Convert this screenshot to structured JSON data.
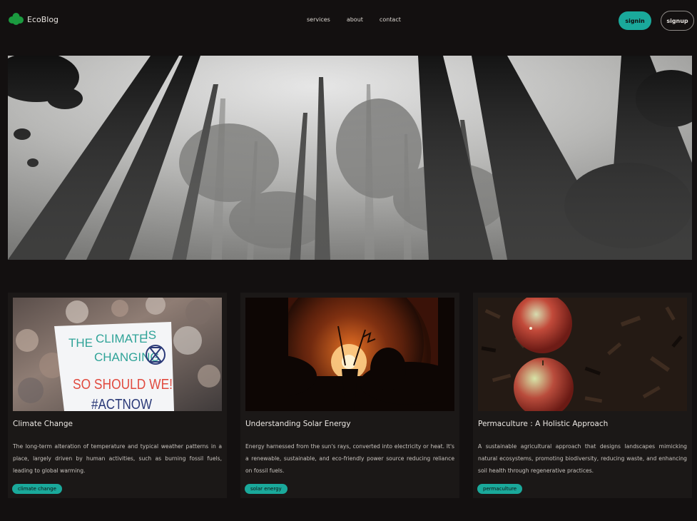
{
  "app": {
    "name": "EcoBlog"
  },
  "nav": {
    "links": [
      "services",
      "about",
      "contact"
    ],
    "signin": "signin",
    "signup": "signup"
  },
  "colors": {
    "accent": "#1aa99b",
    "background": "#131010",
    "card": "#1b1817",
    "logo": "#1b9a3f"
  },
  "hero": {
    "image": "misty-forest-canopy"
  },
  "cards": [
    {
      "title": "Climate Change",
      "description": "The long-term alteration of temperature and typical weather patterns in a place, largely driven by human activities, such as burning fossil fuels, leading to global warming.",
      "tag": "climate change",
      "image": "climate-protest-sign",
      "sign": [
        "THE",
        "CLIMATE",
        "IS",
        "CHANGING",
        "SO SHOULD WE!",
        "#ACTNOW"
      ]
    },
    {
      "title": "Understanding Solar Energy",
      "description": "Energy harnessed from the sun's rays, converted into electricity or heat. It's a renewable, sustainable, and eco-friendly power source reducing reliance on fossil fuels.",
      "tag": "solar energy",
      "image": "glowing-light-bulb"
    },
    {
      "title": "Permaculture : A Holistic Approach",
      "description": "A sustainable agricultural approach that designs landscapes mimicking natural ecosystems, promoting biodiversity, reducing waste, and enhancing soil health through regenerative practices.",
      "tag": "permaculture",
      "image": "apples-on-mulch"
    }
  ]
}
